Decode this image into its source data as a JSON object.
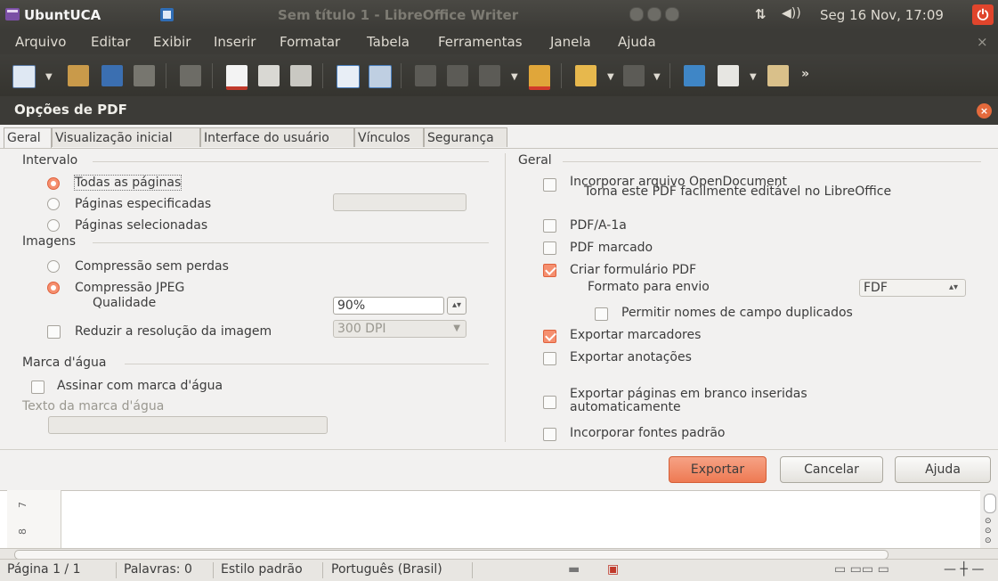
{
  "topbar": {
    "brand": "UbuntUCA",
    "window_title": "Sem título 1 - LibreOffice Writer",
    "net": "⇅",
    "volume": "◀))",
    "clock": "Seg 16 Nov, 17:09",
    "power": "⏻"
  },
  "menu": {
    "items": [
      "Arquivo",
      "Editar",
      "Exibir",
      "Inserir",
      "Formatar",
      "Tabela",
      "Ferramentas",
      "Janela",
      "Ajuda"
    ],
    "close": "×"
  },
  "toolbar": {
    "more": "»"
  },
  "dialog": {
    "title": "Opções de PDF",
    "close": "×",
    "tabs": [
      "Geral",
      "Visualização inicial",
      "Interface do usuário",
      "Vínculos",
      "Segurança"
    ],
    "active_tab": "Geral",
    "range": {
      "heading": "Intervalo",
      "all_pages": "Todas as páginas",
      "specified_pages": "Páginas especificadas",
      "selected_pages": "Páginas selecionadas",
      "selected": "all_pages"
    },
    "images": {
      "heading": "Imagens",
      "lossless": "Compressão sem perdas",
      "jpeg": "Compressão JPEG",
      "quality_label": "Qualidade",
      "quality_value": "90%",
      "reduce_resolution": "Reduzir a resolução da imagem",
      "dpi_value": "300 DPI",
      "selected": "jpeg",
      "reduce_checked": false
    },
    "watermark": {
      "heading": "Marca d'água",
      "sign": "Assinar com marca d'água",
      "text_label": "Texto da marca d'água",
      "text_value": "",
      "sign_checked": false
    },
    "general": {
      "heading": "Geral",
      "embed_odf": "Incorporar arquivo OpenDocument",
      "embed_odf_hint": "Torna este PDF facilmente editável no LibreOffice",
      "pdfa": "PDF/A-1a",
      "tagged_pdf": "PDF marcado",
      "create_form": "Criar formulário PDF",
      "submit_format_label": "Formato para envio",
      "submit_format_value": "FDF",
      "allow_duplicate_fields": "Permitir nomes de campo duplicados",
      "export_bookmarks": "Exportar marcadores",
      "export_comments": "Exportar anotações",
      "export_blank_pages": "Exportar páginas em branco inseridas automaticamente",
      "embed_fonts": "Incorporar fontes padrão",
      "checked": {
        "embed_odf": false,
        "pdfa": false,
        "tagged_pdf": false,
        "create_form": true,
        "allow_duplicate_fields": false,
        "export_bookmarks": true,
        "export_comments": false,
        "export_blank_pages": false,
        "embed_fonts": false
      }
    },
    "buttons": {
      "export": "Exportar",
      "cancel": "Cancelar",
      "help": "Ajuda"
    }
  },
  "document": {
    "ruler_marks": [
      "7",
      "8"
    ]
  },
  "statusbar": {
    "page": "Página 1 / 1",
    "words": "Palavras: 0",
    "style": "Estilo padrão",
    "language": "Português (Brasil)"
  },
  "colors": {
    "accent": "#f07746",
    "panel": "#3c3b37",
    "dialog_bg": "#f2f1f0"
  }
}
